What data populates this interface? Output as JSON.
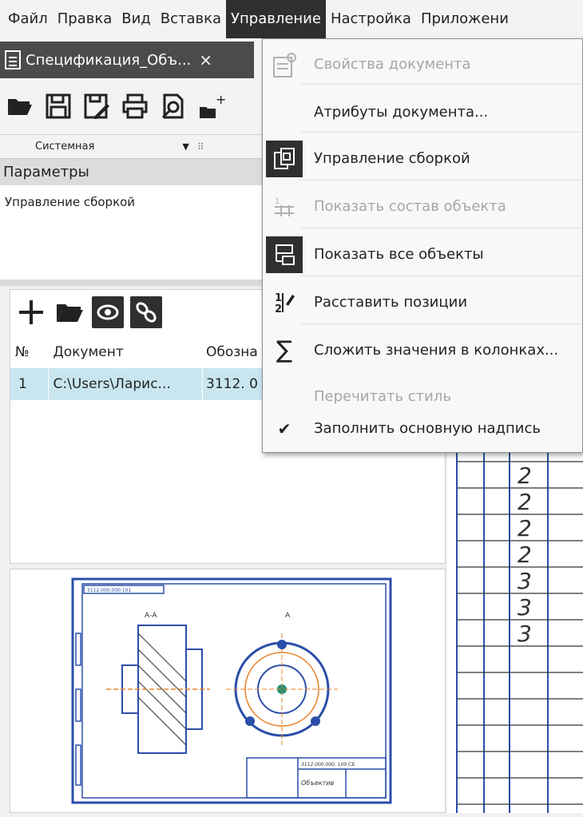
{
  "menubar": {
    "items": [
      "Файл",
      "Правка",
      "Вид",
      "Вставка",
      "Управление",
      "Настройка",
      "Приложени"
    ],
    "active_index": 4
  },
  "tab": {
    "title": "Спецификация_Объ...",
    "close": "×"
  },
  "toolbar": {
    "icons": [
      "open-folder-icon",
      "save-icon",
      "save-as-icon",
      "print-icon",
      "preview-icon",
      "new-doc-icon"
    ]
  },
  "style_row": {
    "name": "Системная"
  },
  "params": {
    "header": "Параметры",
    "text": "Управление сборкой"
  },
  "table": {
    "headers": [
      "№",
      "Документ",
      "Обозна"
    ],
    "rows": [
      [
        "1",
        "C:\\Users\\Ларис...",
        "3112. 0"
      ]
    ]
  },
  "drawing": {
    "section_label": "А-А",
    "view_label": "А",
    "title_code": "3112.000.000. 100 СБ",
    "title_name": "Объектив",
    "corner_code": "3112.000.000.101"
  },
  "sheet": {
    "values": [
      "2",
      "2",
      "2",
      "2",
      "3",
      "3",
      "3"
    ]
  },
  "dropdown": {
    "items": [
      {
        "label": "Свойства документа",
        "disabled": true,
        "icon": "document-properties-icon"
      },
      {
        "label": "Атрибуты документа...",
        "disabled": false,
        "icon": ""
      },
      {
        "label": "Управление сборкой",
        "disabled": false,
        "icon": "assembly-management-icon"
      },
      {
        "label": "Показать состав объекта",
        "disabled": true,
        "icon": "object-composition-icon"
      },
      {
        "label": "Показать все объекты",
        "disabled": false,
        "icon": "show-all-objects-icon"
      },
      {
        "label": "Расставить позиции",
        "disabled": false,
        "icon": "arrange-positions-icon"
      },
      {
        "label": "Сложить значения в колонках...",
        "disabled": false,
        "icon": "sum-icon"
      },
      {
        "label": "Перечитать стиль",
        "disabled": true,
        "icon": ""
      },
      {
        "label": "Заполнить основную надпись",
        "disabled": false,
        "icon": "checkmark-icon"
      }
    ],
    "sum_symbol": "∑",
    "check_symbol": "✔"
  }
}
